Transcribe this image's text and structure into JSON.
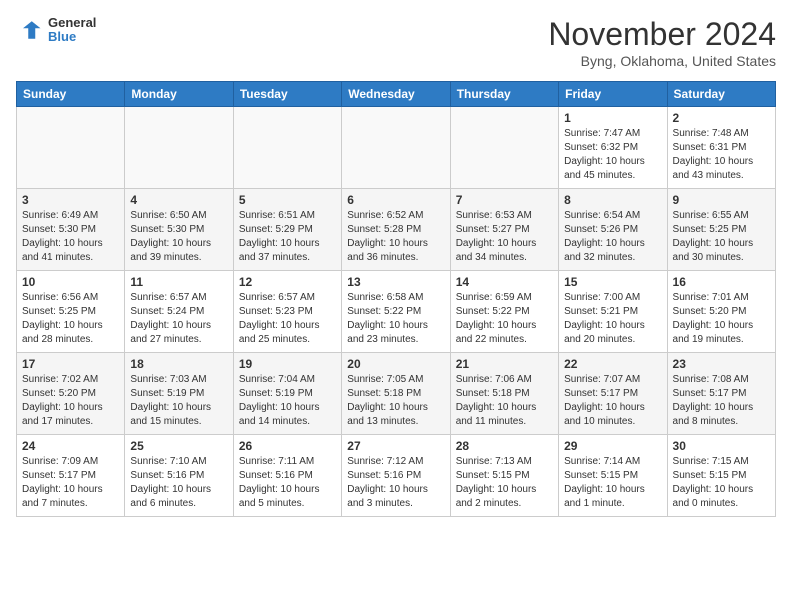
{
  "header": {
    "logo_line1": "General",
    "logo_line2": "Blue",
    "title": "November 2024",
    "location": "Byng, Oklahoma, United States"
  },
  "days_of_week": [
    "Sunday",
    "Monday",
    "Tuesday",
    "Wednesday",
    "Thursday",
    "Friday",
    "Saturday"
  ],
  "weeks": [
    [
      {
        "day": "",
        "info": ""
      },
      {
        "day": "",
        "info": ""
      },
      {
        "day": "",
        "info": ""
      },
      {
        "day": "",
        "info": ""
      },
      {
        "day": "",
        "info": ""
      },
      {
        "day": "1",
        "info": "Sunrise: 7:47 AM\nSunset: 6:32 PM\nDaylight: 10 hours\nand 45 minutes."
      },
      {
        "day": "2",
        "info": "Sunrise: 7:48 AM\nSunset: 6:31 PM\nDaylight: 10 hours\nand 43 minutes."
      }
    ],
    [
      {
        "day": "3",
        "info": "Sunrise: 6:49 AM\nSunset: 5:30 PM\nDaylight: 10 hours\nand 41 minutes."
      },
      {
        "day": "4",
        "info": "Sunrise: 6:50 AM\nSunset: 5:30 PM\nDaylight: 10 hours\nand 39 minutes."
      },
      {
        "day": "5",
        "info": "Sunrise: 6:51 AM\nSunset: 5:29 PM\nDaylight: 10 hours\nand 37 minutes."
      },
      {
        "day": "6",
        "info": "Sunrise: 6:52 AM\nSunset: 5:28 PM\nDaylight: 10 hours\nand 36 minutes."
      },
      {
        "day": "7",
        "info": "Sunrise: 6:53 AM\nSunset: 5:27 PM\nDaylight: 10 hours\nand 34 minutes."
      },
      {
        "day": "8",
        "info": "Sunrise: 6:54 AM\nSunset: 5:26 PM\nDaylight: 10 hours\nand 32 minutes."
      },
      {
        "day": "9",
        "info": "Sunrise: 6:55 AM\nSunset: 5:25 PM\nDaylight: 10 hours\nand 30 minutes."
      }
    ],
    [
      {
        "day": "10",
        "info": "Sunrise: 6:56 AM\nSunset: 5:25 PM\nDaylight: 10 hours\nand 28 minutes."
      },
      {
        "day": "11",
        "info": "Sunrise: 6:57 AM\nSunset: 5:24 PM\nDaylight: 10 hours\nand 27 minutes."
      },
      {
        "day": "12",
        "info": "Sunrise: 6:57 AM\nSunset: 5:23 PM\nDaylight: 10 hours\nand 25 minutes."
      },
      {
        "day": "13",
        "info": "Sunrise: 6:58 AM\nSunset: 5:22 PM\nDaylight: 10 hours\nand 23 minutes."
      },
      {
        "day": "14",
        "info": "Sunrise: 6:59 AM\nSunset: 5:22 PM\nDaylight: 10 hours\nand 22 minutes."
      },
      {
        "day": "15",
        "info": "Sunrise: 7:00 AM\nSunset: 5:21 PM\nDaylight: 10 hours\nand 20 minutes."
      },
      {
        "day": "16",
        "info": "Sunrise: 7:01 AM\nSunset: 5:20 PM\nDaylight: 10 hours\nand 19 minutes."
      }
    ],
    [
      {
        "day": "17",
        "info": "Sunrise: 7:02 AM\nSunset: 5:20 PM\nDaylight: 10 hours\nand 17 minutes."
      },
      {
        "day": "18",
        "info": "Sunrise: 7:03 AM\nSunset: 5:19 PM\nDaylight: 10 hours\nand 15 minutes."
      },
      {
        "day": "19",
        "info": "Sunrise: 7:04 AM\nSunset: 5:19 PM\nDaylight: 10 hours\nand 14 minutes."
      },
      {
        "day": "20",
        "info": "Sunrise: 7:05 AM\nSunset: 5:18 PM\nDaylight: 10 hours\nand 13 minutes."
      },
      {
        "day": "21",
        "info": "Sunrise: 7:06 AM\nSunset: 5:18 PM\nDaylight: 10 hours\nand 11 minutes."
      },
      {
        "day": "22",
        "info": "Sunrise: 7:07 AM\nSunset: 5:17 PM\nDaylight: 10 hours\nand 10 minutes."
      },
      {
        "day": "23",
        "info": "Sunrise: 7:08 AM\nSunset: 5:17 PM\nDaylight: 10 hours\nand 8 minutes."
      }
    ],
    [
      {
        "day": "24",
        "info": "Sunrise: 7:09 AM\nSunset: 5:17 PM\nDaylight: 10 hours\nand 7 minutes."
      },
      {
        "day": "25",
        "info": "Sunrise: 7:10 AM\nSunset: 5:16 PM\nDaylight: 10 hours\nand 6 minutes."
      },
      {
        "day": "26",
        "info": "Sunrise: 7:11 AM\nSunset: 5:16 PM\nDaylight: 10 hours\nand 5 minutes."
      },
      {
        "day": "27",
        "info": "Sunrise: 7:12 AM\nSunset: 5:16 PM\nDaylight: 10 hours\nand 3 minutes."
      },
      {
        "day": "28",
        "info": "Sunrise: 7:13 AM\nSunset: 5:15 PM\nDaylight: 10 hours\nand 2 minutes."
      },
      {
        "day": "29",
        "info": "Sunrise: 7:14 AM\nSunset: 5:15 PM\nDaylight: 10 hours\nand 1 minute."
      },
      {
        "day": "30",
        "info": "Sunrise: 7:15 AM\nSunset: 5:15 PM\nDaylight: 10 hours\nand 0 minutes."
      }
    ]
  ]
}
